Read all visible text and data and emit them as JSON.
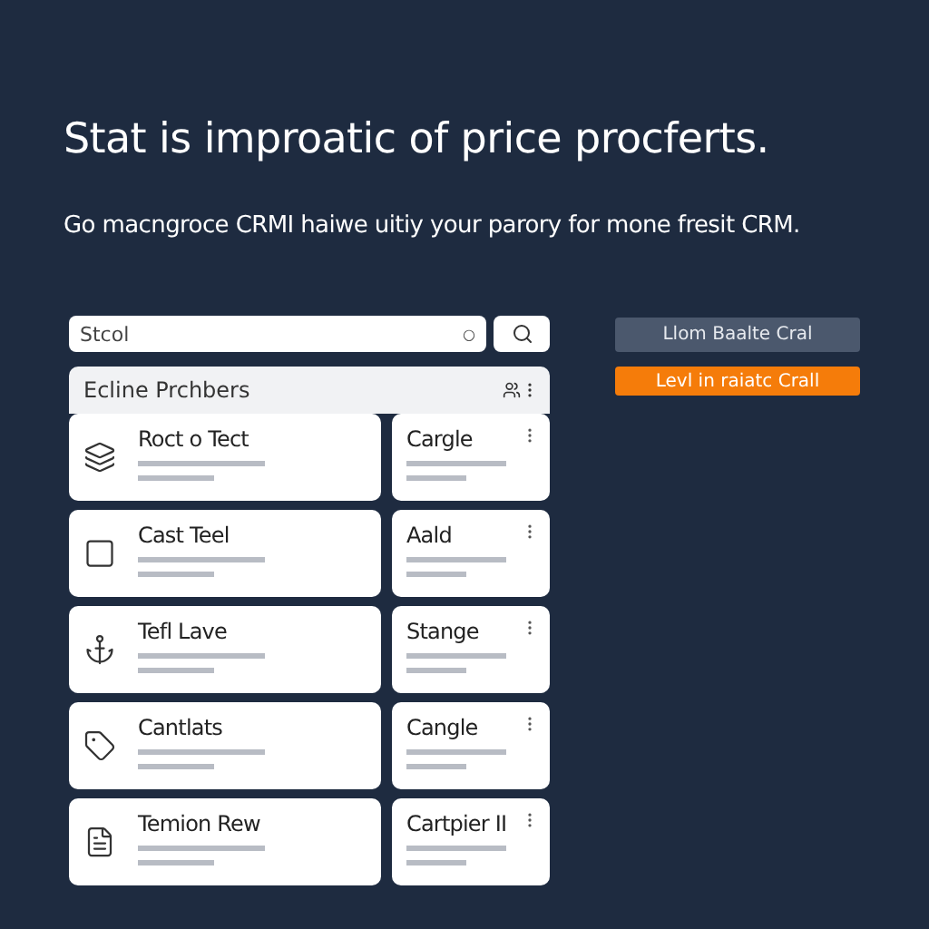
{
  "headline": "Stat is improatic of price procferts.",
  "subtitle": "Go macngroce CRMI haiwe uitiy your parory for mone fresit CRM.",
  "search": {
    "placeholder": "Stcol",
    "clear": "○"
  },
  "panel": {
    "title": "Ecline Prchbers"
  },
  "rows": [
    {
      "kind": "layers",
      "title": "Roct o Tect",
      "side_title": "Cargle"
    },
    {
      "kind": "frame",
      "title": "Cast Teel",
      "side_title": "Aald"
    },
    {
      "kind": "anchor",
      "title": "Tefl Lave",
      "side_title": "Stange"
    },
    {
      "kind": "tag",
      "title": "Cantlats",
      "side_title": "Cangle"
    },
    {
      "kind": "document",
      "title": "Temion Rew",
      "side_title": "Cartpier II"
    }
  ],
  "buttons": [
    {
      "label": "Llom Baalte Cral",
      "kind": "secondary"
    },
    {
      "label": "Levl in raiatc Crall",
      "kind": "primary"
    }
  ]
}
